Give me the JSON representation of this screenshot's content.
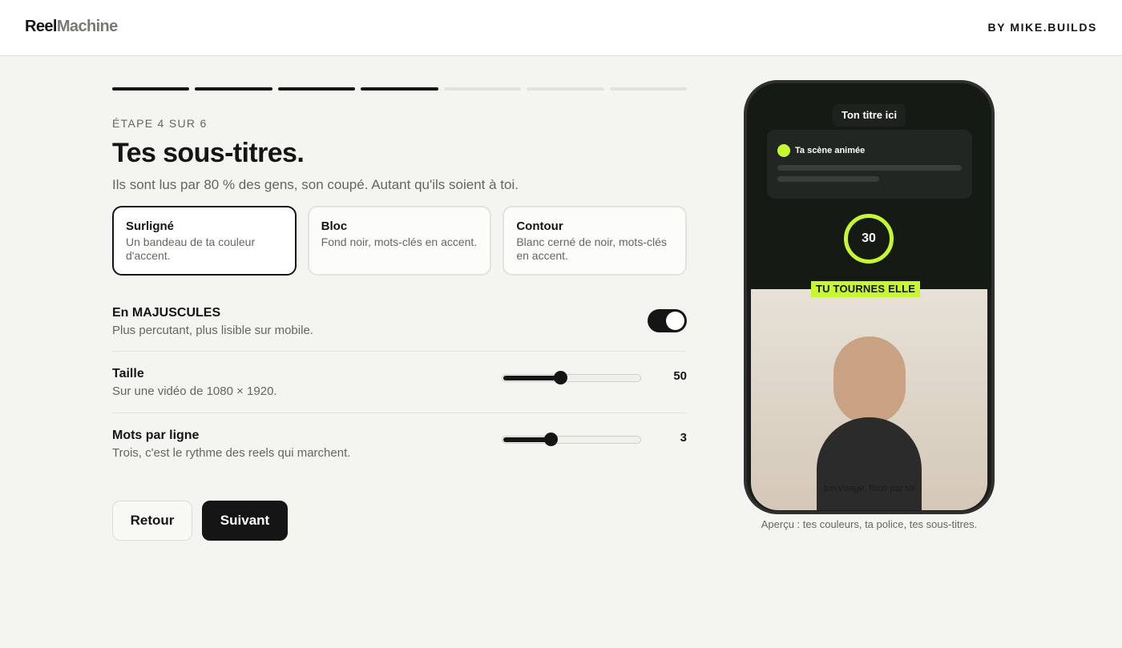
{
  "header": {
    "logo_bold": "Reel",
    "logo_light": "Machine",
    "byline": "BY MIKE.BUILDS"
  },
  "wizard": {
    "total_steps": 7,
    "completed_steps": 4,
    "step_label": "ÉTAPE 4 SUR 6",
    "title": "Tes sous-titres.",
    "subtitle": "Ils sont lus par 80 % des gens, son coupé. Autant qu'ils soient à toi."
  },
  "styles": [
    {
      "title": "Surligné",
      "desc": "Un bandeau de ta couleur d'accent.",
      "selected": true
    },
    {
      "title": "Bloc",
      "desc": "Fond noir, mots-clés en accent.",
      "selected": false
    },
    {
      "title": "Contour",
      "desc": "Blanc cerné de noir, mots-clés en accent.",
      "selected": false
    }
  ],
  "settings": {
    "uppercase": {
      "title": "En MAJUSCULES",
      "desc": "Plus percutant, plus lisible sur mobile.",
      "enabled": true
    },
    "size": {
      "title": "Taille",
      "desc": "Sur une vidéo de 1080 × 1920.",
      "value": "50",
      "fraction": 0.42
    },
    "words": {
      "title": "Mots par ligne",
      "desc": "Trois, c'est le rythme des reels qui marchent.",
      "value": "3",
      "fraction": 0.35
    }
  },
  "buttons": {
    "back": "Retour",
    "next": "Suivant"
  },
  "preview": {
    "title": "Ton titre ici",
    "scene_label": "Ta scène animée",
    "countdown": "30",
    "subtitle": "TU TOURNES ELLE",
    "video_caption": "ton visage, filmé par toi",
    "caption": "Aperçu : tes couleurs, ta police, tes sous-titres.",
    "accent_color": "#c6f72f"
  }
}
